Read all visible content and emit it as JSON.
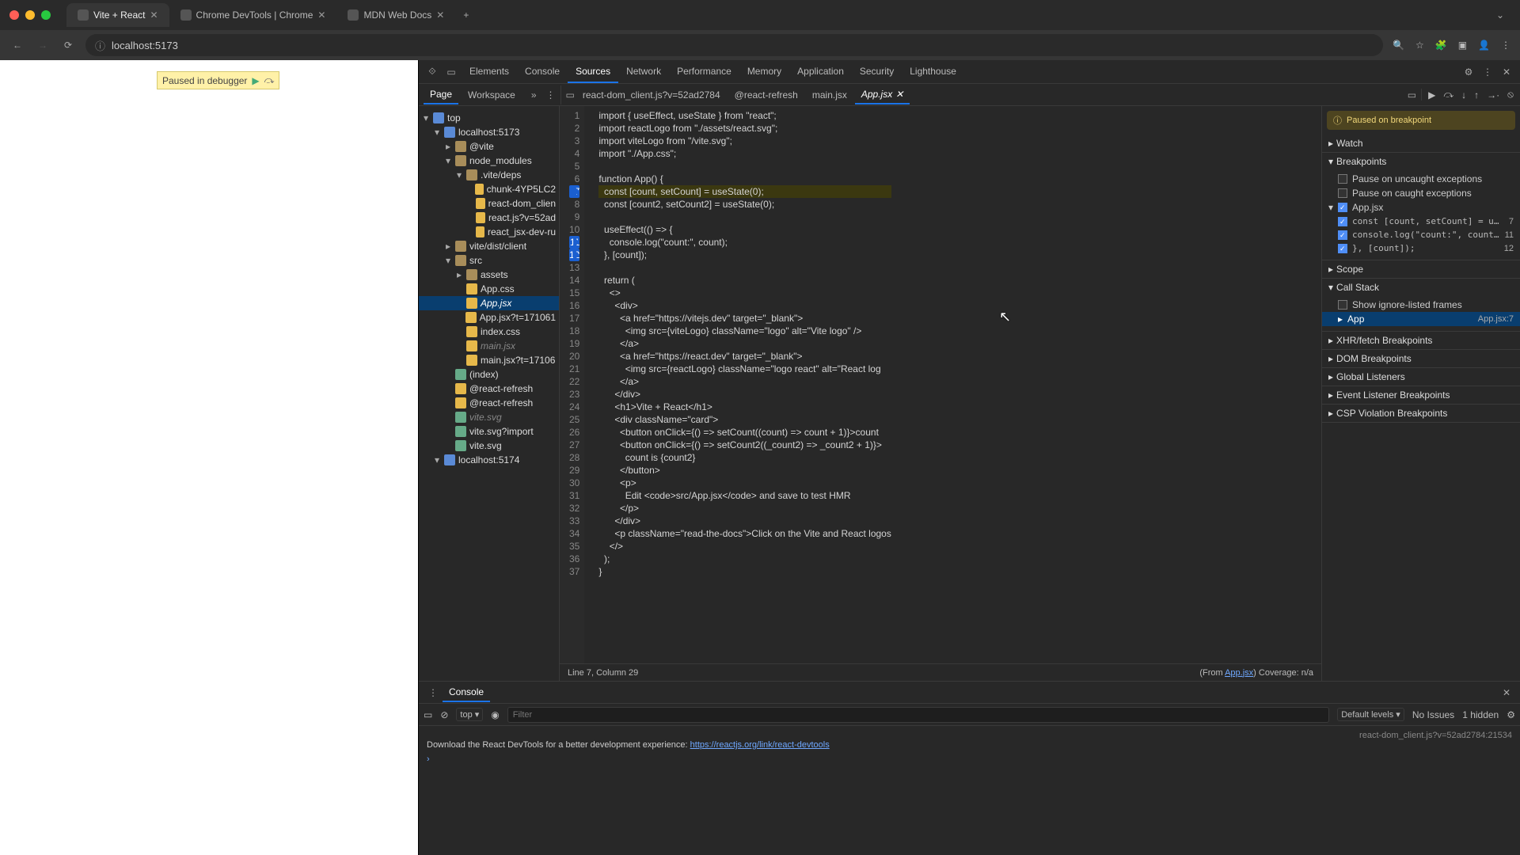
{
  "browser": {
    "tabs": [
      {
        "title": "Vite + React",
        "active": true
      },
      {
        "title": "Chrome DevTools | Chrome",
        "active": false
      },
      {
        "title": "MDN Web Docs",
        "active": false
      }
    ],
    "new_tab": "+",
    "url": "localhost:5173"
  },
  "viewport": {
    "paused_label": "Paused in debugger"
  },
  "devtools": {
    "tabs": [
      "Elements",
      "Console",
      "Sources",
      "Network",
      "Performance",
      "Memory",
      "Application",
      "Security",
      "Lighthouse"
    ],
    "active_tab": "Sources",
    "source_nav": {
      "tabs": [
        "Page",
        "Workspace"
      ],
      "active": "Page"
    },
    "open_files": [
      "react-dom_client.js?v=52ad2784",
      "@react-refresh",
      "main.jsx",
      "App.jsx"
    ],
    "open_active": "App.jsx",
    "debug_icons": [
      "resume",
      "step-over",
      "step-into",
      "step-out",
      "step",
      "deactivate-bp"
    ],
    "filetree": [
      {
        "d": 0,
        "tw": "▾",
        "ico": "page",
        "label": "top"
      },
      {
        "d": 1,
        "tw": "▾",
        "ico": "cloud",
        "label": "localhost:5173"
      },
      {
        "d": 2,
        "tw": "▸",
        "ico": "folder",
        "label": "@vite"
      },
      {
        "d": 2,
        "tw": "▾",
        "ico": "folder",
        "label": "node_modules"
      },
      {
        "d": 3,
        "tw": "▾",
        "ico": "folder",
        "label": ".vite/deps"
      },
      {
        "d": 4,
        "tw": "",
        "ico": "js",
        "label": "chunk-4YP5LC2"
      },
      {
        "d": 4,
        "tw": "",
        "ico": "js",
        "label": "react-dom_clien"
      },
      {
        "d": 4,
        "tw": "",
        "ico": "js",
        "label": "react.js?v=52ad"
      },
      {
        "d": 4,
        "tw": "",
        "ico": "js",
        "label": "react_jsx-dev-ru"
      },
      {
        "d": 2,
        "tw": "▸",
        "ico": "folder",
        "label": "vite/dist/client"
      },
      {
        "d": 2,
        "tw": "▾",
        "ico": "folder",
        "label": "src"
      },
      {
        "d": 3,
        "tw": "▸",
        "ico": "folder",
        "label": "assets"
      },
      {
        "d": 3,
        "tw": "",
        "ico": "js",
        "label": "App.css"
      },
      {
        "d": 3,
        "tw": "",
        "ico": "js",
        "label": "App.jsx",
        "selected": true,
        "italic": true
      },
      {
        "d": 3,
        "tw": "",
        "ico": "js",
        "label": "App.jsx?t=171061"
      },
      {
        "d": 3,
        "tw": "",
        "ico": "js",
        "label": "index.css"
      },
      {
        "d": 3,
        "tw": "",
        "ico": "js",
        "label": "main.jsx",
        "muted": true
      },
      {
        "d": 3,
        "tw": "",
        "ico": "js",
        "label": "main.jsx?t=17106"
      },
      {
        "d": 2,
        "tw": "",
        "ico": "file",
        "label": "(index)"
      },
      {
        "d": 2,
        "tw": "",
        "ico": "js",
        "label": "@react-refresh"
      },
      {
        "d": 2,
        "tw": "",
        "ico": "js",
        "label": "@react-refresh"
      },
      {
        "d": 2,
        "tw": "",
        "ico": "file",
        "label": "vite.svg",
        "muted": true
      },
      {
        "d": 2,
        "tw": "",
        "ico": "file",
        "label": "vite.svg?import"
      },
      {
        "d": 2,
        "tw": "",
        "ico": "file",
        "label": "vite.svg"
      },
      {
        "d": 1,
        "tw": "▾",
        "ico": "cloud",
        "label": "localhost:5174"
      }
    ],
    "code": {
      "lines": [
        "import { useEffect, useState } from \"react\";",
        "import reactLogo from \"./assets/react.svg\";",
        "import viteLogo from \"/vite.svg\";",
        "import \"./App.css\";",
        "",
        "function App() {",
        "  const [count, setCount] = useState(0);",
        "  const [count2, setCount2] = useState(0);",
        "",
        "  useEffect(() => {",
        "    console.log(\"count:\", count);",
        "  }, [count]);",
        "",
        "  return (",
        "    <>",
        "      <div>",
        "        <a href=\"https://vitejs.dev\" target=\"_blank\">",
        "          <img src={viteLogo} className=\"logo\" alt=\"Vite logo\" />",
        "        </a>",
        "        <a href=\"https://react.dev\" target=\"_blank\">",
        "          <img src={reactLogo} className=\"logo react\" alt=\"React log",
        "        </a>",
        "      </div>",
        "      <h1>Vite + React</h1>",
        "      <div className=\"card\">",
        "        <button onClick={() => setCount((count) => count + 1)}>count",
        "        <button onClick={() => setCount2((_count2) => _count2 + 1)}>",
        "          count is {count2}",
        "        </button>",
        "        <p>",
        "          Edit <code>src/App.jsx</code> and save to test HMR",
        "        </p>",
        "      </div>",
        "      <p className=\"read-the-docs\">Click on the Vite and React logos",
        "    </>",
        "  );",
        "}"
      ],
      "breakpoint_lines": [
        7,
        11,
        12
      ],
      "highlight_line": 7
    },
    "status": {
      "left": "Line 7, Column 29",
      "right_from": "(From ",
      "right_link": "App.jsx",
      "right_cov": ")  Coverage: n/a"
    },
    "debugger": {
      "paused_msg": "Paused on breakpoint",
      "sections": {
        "watch": "Watch",
        "breakpoints": "Breakpoints",
        "scope": "Scope",
        "callstack": "Call Stack",
        "xhr": "XHR/fetch Breakpoints",
        "dom": "DOM Breakpoints",
        "global": "Global Listeners",
        "event": "Event Listener Breakpoints",
        "csp": "CSP Violation Breakpoints"
      },
      "pause_uncaught": "Pause on uncaught exceptions",
      "pause_caught": "Pause on caught exceptions",
      "bp_file": "App.jsx",
      "bp_items": [
        {
          "code": "const [count, setCount] = us…",
          "line": "7"
        },
        {
          "code": "console.log(\"count:\", count);",
          "line": "11"
        },
        {
          "code": "}, [count]);",
          "line": "12"
        }
      ],
      "callstack": {
        "show_ignored": "Show ignore-listed frames",
        "frame": "App",
        "frame_loc": "App.jsx:7"
      }
    }
  },
  "console": {
    "tab": "Console",
    "context": "top",
    "filter_ph": "Filter",
    "levels": "Default levels",
    "issues": "No Issues",
    "hidden": "1 hidden",
    "msg_src": "react-dom_client.js?v=52ad2784:21534",
    "msg_pre": "Download the React DevTools for a better development experience: ",
    "msg_link": "https://reactjs.org/link/react-devtools"
  }
}
